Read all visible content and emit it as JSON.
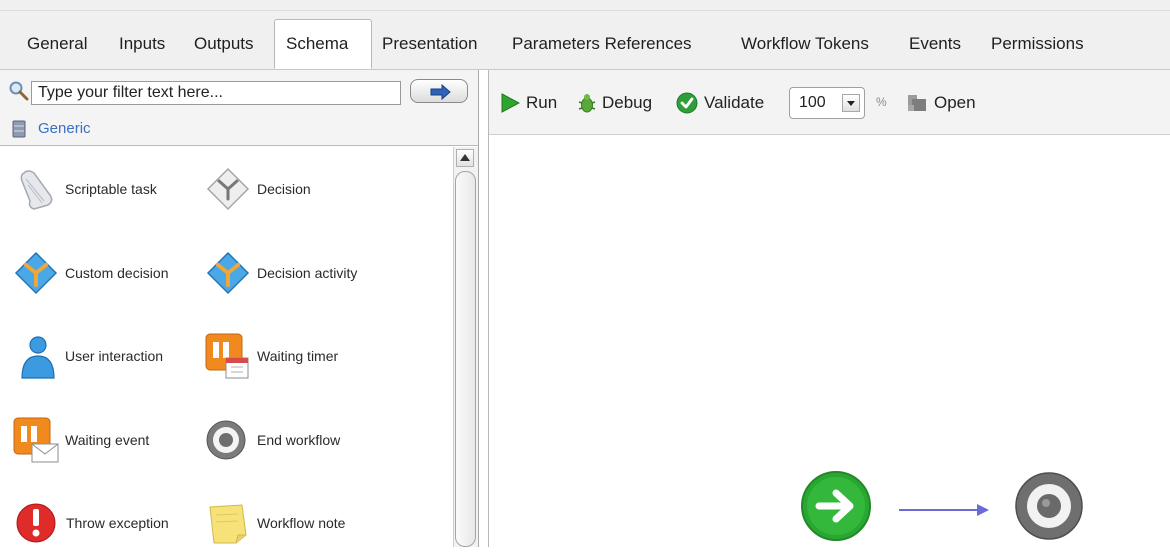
{
  "tabs": [
    {
      "label": "General"
    },
    {
      "label": "Inputs"
    },
    {
      "label": "Outputs"
    },
    {
      "label": "Schema",
      "active": true
    },
    {
      "label": "Presentation"
    },
    {
      "label": "Parameters References"
    },
    {
      "label": "Workflow Tokens"
    },
    {
      "label": "Events"
    },
    {
      "label": "Permissions"
    }
  ],
  "palette": {
    "filter": {
      "value": "Type your filter text here..."
    },
    "group": {
      "label": "Generic"
    },
    "items": [
      {
        "label": "Scriptable task",
        "icon": "scroll-icon"
      },
      {
        "label": "Decision",
        "icon": "decision-icon"
      },
      {
        "label": "Custom decision",
        "icon": "custom-decision-icon"
      },
      {
        "label": "Decision activity",
        "icon": "decision-activity-icon"
      },
      {
        "label": "User interaction",
        "icon": "user-icon"
      },
      {
        "label": "Waiting timer",
        "icon": "timer-icon"
      },
      {
        "label": "Waiting event",
        "icon": "event-icon"
      },
      {
        "label": "End workflow",
        "icon": "end-icon"
      },
      {
        "label": "Throw exception",
        "icon": "exception-icon"
      },
      {
        "label": "Workflow note",
        "icon": "note-icon"
      }
    ]
  },
  "toolbar": {
    "run_label": "Run",
    "debug_label": "Debug",
    "validate_label": "Validate",
    "zoom_value": "100",
    "percent_label": "%",
    "open_label": "Open"
  },
  "colors": {
    "run_green": "#2fa52f",
    "validate_green": "#2f9e3a",
    "start_green": "#2aa632",
    "link_blue": "#3a6fc2",
    "arrow_blue": "#6a6ad8"
  }
}
